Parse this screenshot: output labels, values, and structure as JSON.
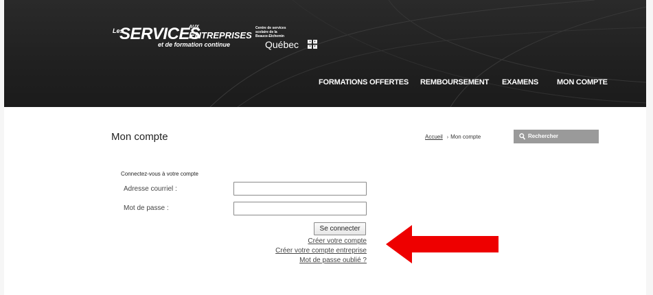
{
  "header": {
    "logo": {
      "les": "Les",
      "services": "SERVICES",
      "aux": "AUX",
      "entreprises": "ENTREPRISES",
      "formation": "et de formation continue"
    },
    "cs": {
      "line1": "Centre de services",
      "line2": "scolaire de la",
      "line3": "Beauce-Etchemin",
      "quebec": "Québec"
    },
    "nav": [
      {
        "label": "FORMATIONS OFFERTES"
      },
      {
        "label": "REMBOURSEMENT"
      },
      {
        "label": "EXAMENS"
      },
      {
        "label": "MON COMPTE"
      }
    ]
  },
  "page": {
    "title": "Mon compte",
    "breadcrumb": {
      "home": "Accueil",
      "separator": "›",
      "current": "Mon compte"
    },
    "search": {
      "placeholder": "Rechercher",
      "icon": "search-icon"
    }
  },
  "login": {
    "heading": "Connectez-vous à votre compte",
    "email_label": "Adresse courriel :",
    "password_label": "Mot de passe :",
    "email_value": "",
    "password_value": "",
    "submit_label": "Se connecter",
    "links": {
      "create_account": "Créer votre compte",
      "create_business_account": "Créer votre compte entreprise",
      "forgot_password": "Mot de passe oublié ?"
    }
  },
  "colors": {
    "header_bg": "#202020",
    "search_bg": "#9a9a9a",
    "arrow": "#ee0000"
  }
}
